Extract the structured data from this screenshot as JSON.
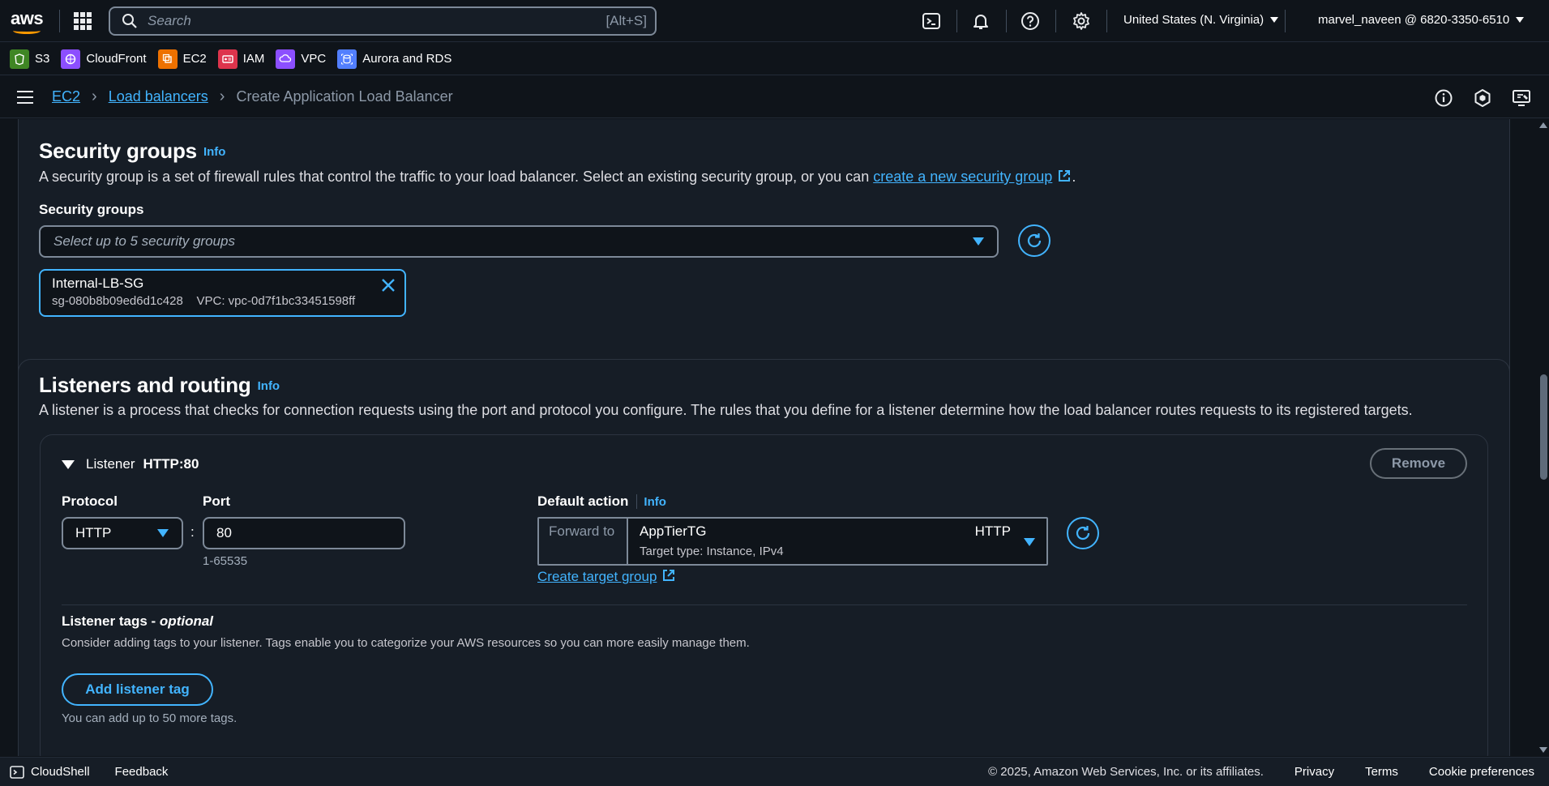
{
  "topnav": {
    "logo_text": "aws",
    "search_placeholder": "Search",
    "search_shortcut": "[Alt+S]",
    "region": "United States (N. Virginia)",
    "account": "marvel_naveen @ 6820-3350-6510"
  },
  "favorites": [
    {
      "label": "S3",
      "color": "#3f8624"
    },
    {
      "label": "CloudFront",
      "color": "#8c4fff"
    },
    {
      "label": "EC2",
      "color": "#ed7100"
    },
    {
      "label": "IAM",
      "color": "#dd344c"
    },
    {
      "label": "VPC",
      "color": "#8c4fff"
    },
    {
      "label": "Aurora and RDS",
      "color": "#527fff"
    }
  ],
  "breadcrumb": {
    "ec2": "EC2",
    "load_balancers": "Load balancers",
    "current": "Create Application Load Balancer"
  },
  "security_groups": {
    "title": "Security groups",
    "info": "Info",
    "description": "A security group is a set of firewall rules that control the traffic to your load balancer. Select an existing security group, or you can ",
    "create_link": "create a new security group",
    "description_end": ".",
    "field_label": "Security groups",
    "select_placeholder": "Select up to 5 security groups",
    "selected": {
      "name": "Internal-LB-SG",
      "id": "sg-080b8b09ed6d1c428",
      "vpc": "VPC: vpc-0d7f1bc33451598ff"
    }
  },
  "listeners": {
    "title": "Listeners and routing",
    "info": "Info",
    "description": "A listener is a process that checks for connection requests using the port and protocol you configure. The rules that you define for a listener determine how the load balancer routes requests to its registered targets.",
    "listener": {
      "label": "Listener",
      "name": "HTTP:80",
      "remove": "Remove",
      "protocol_label": "Protocol",
      "protocol_value": "HTTP",
      "port_label": "Port",
      "port_value": "80",
      "port_hint": "1-65535",
      "separator": ":",
      "default_action_label": "Default action",
      "default_action_info": "Info",
      "forward_to": "Forward to",
      "target_group": "AppTierTG",
      "target_type": "Target type: Instance, IPv4",
      "target_protocol": "HTTP",
      "create_target_group": "Create target group",
      "tags_label": "Listener tags - ",
      "tags_optional": "optional",
      "tags_description": "Consider adding tags to your listener. Tags enable you to categorize your AWS resources so you can more easily manage them.",
      "add_tag": "Add listener tag",
      "tag_hint": "You can add up to 50 more tags."
    }
  },
  "footer": {
    "cloudshell": "CloudShell",
    "feedback": "Feedback",
    "copyright": "© 2025, Amazon Web Services, Inc. or its affiliates.",
    "privacy": "Privacy",
    "terms": "Terms",
    "cookies": "Cookie preferences"
  },
  "colors": {
    "accent": "#42b4ff",
    "background": "#0f141a",
    "panel": "#161d26"
  }
}
